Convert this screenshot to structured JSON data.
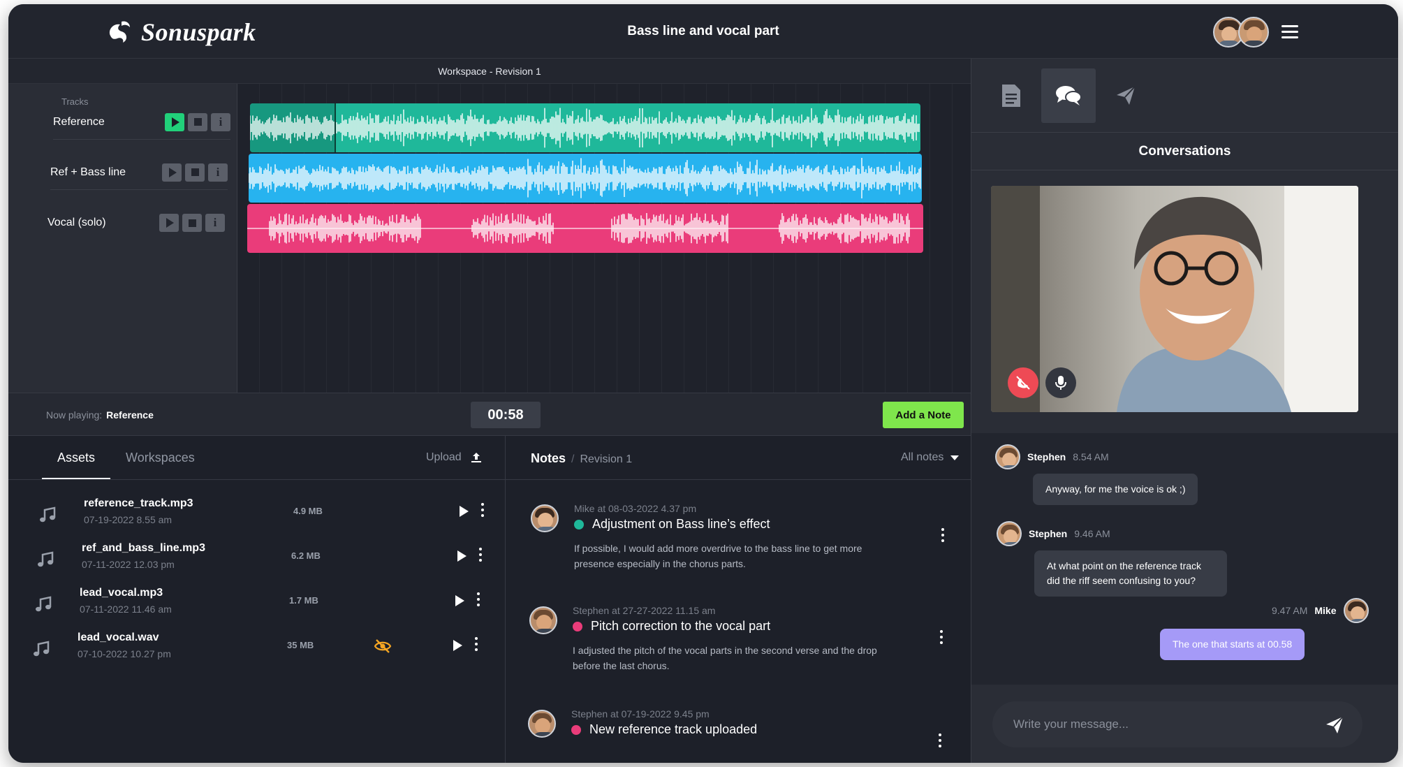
{
  "header": {
    "brand": "Sonuspark",
    "title": "Bass line and vocal part"
  },
  "workspace": {
    "label": "Workspace - Revision 1",
    "tracks_label": "Tracks",
    "tracks": [
      {
        "name": "Reference",
        "color": "#1fb89a",
        "playing": true
      },
      {
        "name": "Ref + Bass line",
        "color": "#27b3ef",
        "playing": false
      },
      {
        "name": "Vocal (solo)",
        "color": "#ea3c7a",
        "playing": false
      }
    ],
    "info_glyph": "i"
  },
  "transport": {
    "now_playing_label": "Now playing:",
    "now_playing_track": "Reference",
    "timecode": "00:58",
    "add_note_label": "Add a Note"
  },
  "assets": {
    "tabs": [
      "Assets",
      "Workspaces"
    ],
    "upload_label": "Upload",
    "items": [
      {
        "name": "reference_track.mp3",
        "date": "07-19-2022 8.55 am",
        "size": "4.9 MB",
        "hidden": false
      },
      {
        "name": "ref_and_bass_line.mp3",
        "date": "07-11-2022 12.03 pm",
        "size": "6.2 MB",
        "hidden": false
      },
      {
        "name": "lead_vocal.mp3",
        "date": "07-11-2022 11.46 am",
        "size": "1.7 MB",
        "hidden": false
      },
      {
        "name": "lead_vocal.wav",
        "date": "07-10-2022 10.27 pm",
        "size": "35 MB",
        "hidden": true
      }
    ]
  },
  "notes": {
    "title": "Notes",
    "separator": "/",
    "revision": "Revision 1",
    "filter": "All notes",
    "items": [
      {
        "meta": "Mike at 08-03-2022 4.37 pm",
        "title": "Adjustment on Bass line’s effect",
        "color": "#1fb89a",
        "body": "If possible, I would add more overdrive to the bass line to get more presence especially in the chorus parts."
      },
      {
        "meta": "Stephen at 27-27-2022 11.15 am",
        "title": "Pitch correction to the vocal part",
        "color": "#ea3c7a",
        "body": "I adjusted the pitch of the vocal parts in the second verse and the drop before the last chorus."
      },
      {
        "meta": "Stephen at 07-19-2022 9.45 pm",
        "title": "New reference track uploaded",
        "color": "#ea3c7a",
        "body": ""
      }
    ]
  },
  "conversations": {
    "title": "Conversations",
    "tab_icons": [
      "document-icon",
      "chat-icon",
      "send-icon"
    ],
    "messages": [
      {
        "author": "Stephen",
        "time": "8.54 AM",
        "text": "Anyway, for me the voice is ok ;)",
        "mine": false
      },
      {
        "author": "Stephen",
        "time": "9.46 AM",
        "text": "At what point on the reference track did the riff seem confusing to you?",
        "mine": false
      },
      {
        "author": "Mike",
        "time": "9.47 AM",
        "text": "The one that starts at 00.58",
        "mine": true
      }
    ],
    "composer_placeholder": "Write your message..."
  },
  "colors": {
    "accent_green": "#7fe64c",
    "bubble_mine": "#a59af7",
    "hangup_red": "#ee4a55",
    "hidden_orange": "#f5a623"
  }
}
